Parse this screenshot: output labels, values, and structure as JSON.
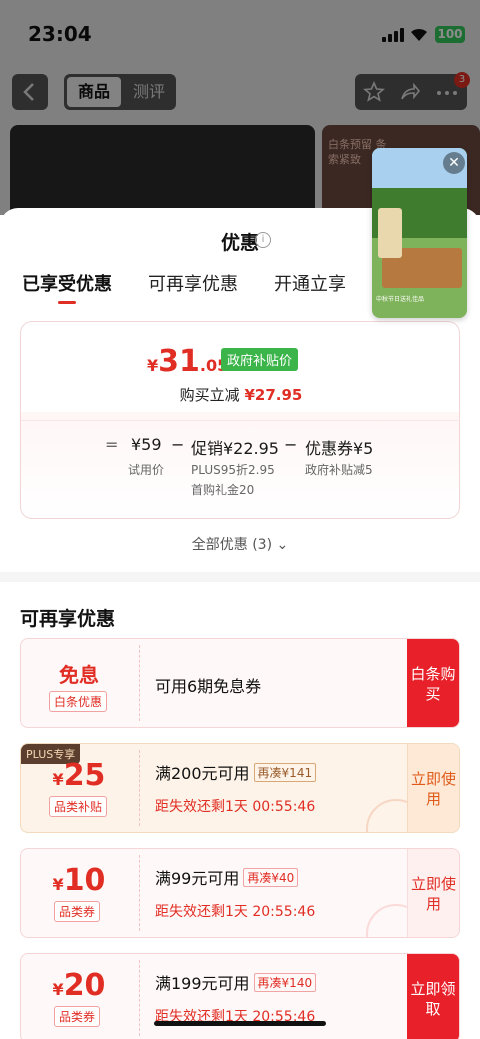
{
  "status_bar": {
    "time": "23:04",
    "battery": "100"
  },
  "nav": {
    "tabs": [
      "商品",
      "测评"
    ],
    "badge": "3"
  },
  "background": {
    "promo_text": "白条预留 条索紧致"
  },
  "sheet": {
    "title": "优惠",
    "tabs": [
      "已享受优惠",
      "可再享优惠",
      "开通立享"
    ],
    "price": {
      "yen": "¥",
      "int": "31",
      "dec": ".05",
      "tag": "政府补贴价"
    },
    "instant": {
      "label": "购买立减",
      "value": "¥27.95"
    },
    "formula": {
      "eq": "=",
      "base": "¥59",
      "base_label": "试用价",
      "minus1": "−",
      "promo": "促销¥22.95",
      "promo_sub1": "PLUS95折2.95",
      "promo_sub2": "首购礼金20",
      "minus2": "−",
      "coupon": "优惠券¥5",
      "coupon_sub": "政府补贴减5"
    },
    "all_offers": "全部优惠 (3) ⌄"
  },
  "more_section": {
    "title": "可再享优惠",
    "coupons": [
      {
        "amount": "免息",
        "label": "白条优惠",
        "main": "可用6期免息券",
        "action": "白条购买"
      },
      {
        "plus": "PLUS专享",
        "yen": "¥",
        "amount": "25",
        "label": "品类补贴",
        "main": "满200元可用",
        "more": "再凑¥141",
        "countdown": "距失效还剩1天 00:55:46",
        "action": "立即使用"
      },
      {
        "yen": "¥",
        "amount": "10",
        "label": "品类券",
        "main": "满99元可用",
        "more": "再凑¥40",
        "countdown": "距失效还剩1天 20:55:46",
        "action": "立即使用"
      },
      {
        "yen": "¥",
        "amount": "20",
        "label": "品类券",
        "main": "满199元可用",
        "more": "再凑¥140",
        "countdown": "距失效还剩1天 20:55:46",
        "action": "立即领取"
      }
    ]
  },
  "video": {
    "caption": "中秋节日送礼佳品"
  }
}
